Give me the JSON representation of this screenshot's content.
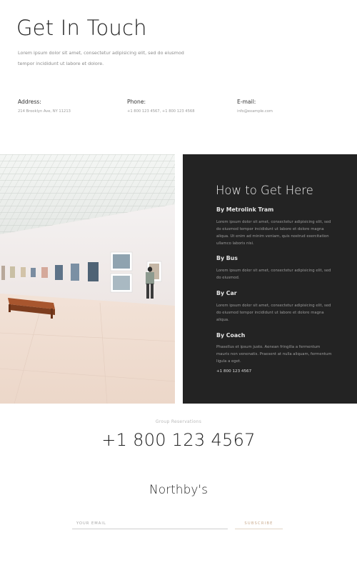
{
  "header": {
    "title": "Get In Touch",
    "intro": "Lorem ipsum dolor sit amet, consectetur adipisicing elit, sed do eiusmod tempor incididunt ut labore et dolore."
  },
  "contacts": [
    {
      "label": "Address:",
      "value": "214 Brooklyn Ave, NY 11213"
    },
    {
      "label": "Phone:",
      "value": "+1 800 123 4567, +1 800 123 4568"
    },
    {
      "label": "E-mail:",
      "value": "info@example.com"
    }
  ],
  "directions": {
    "title": "How to Get Here",
    "routes": [
      {
        "heading": "By Metrolink Tram",
        "text": "Lorem ipsum dolor sit amet, consectetur adipisicing elit, sed do eiusmod tempor incididunt ut labore et dolore magna aliqua. Ut enim ad minim veniam, quis nostrud exercitation ullamco laboris nisi."
      },
      {
        "heading": "By Bus",
        "text": "Lorem ipsum dolor sit amet, consectetur adipisicing elit, sed do eiusmod."
      },
      {
        "heading": "By Car",
        "text": "Lorem ipsum dolor sit amet, consectetur adipisicing elit, sed do eiusmod tempor incididunt ut labore et dolore magna aliqua."
      },
      {
        "heading": "By Coach",
        "text": "Phasellus et ipsum justo. Aenean fringilla a fermentum mauris non venenatis. Praesent at nulla aliquam, fermentum ligula a eget."
      }
    ],
    "phone": "+1 800 123 4567"
  },
  "reservations": {
    "label": "Group Reservations",
    "phone": "+1 800 123 4567"
  },
  "newsletter": {
    "brand": "Northby's",
    "email_placeholder": "YOUR EMAIL",
    "subscribe_label": "SUBSCRIBE"
  },
  "colors": {
    "dark_panel": "#232323",
    "accent": "#c8a98c"
  }
}
